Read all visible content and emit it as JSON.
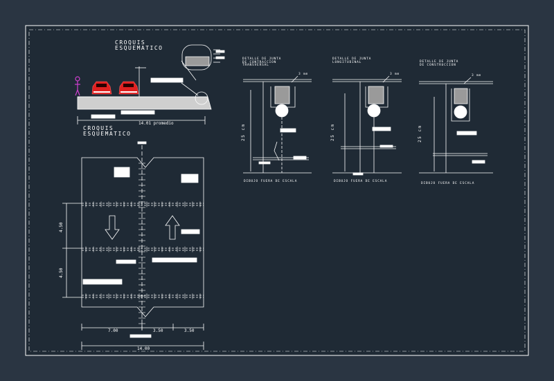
{
  "colors": {
    "background": "#2a3542",
    "sheet": "#1f2a35",
    "line": "#ffffff",
    "accent_car": "#e02020",
    "accent_person": "#d040d0",
    "hatch": "#bbbbbb"
  },
  "sketch_title": "CROQUIS\nESQUEMATICO",
  "plan_title": "CROQUIS\nESQUEMATICO",
  "profile": {
    "width_label": "14.01 promedio"
  },
  "plan": {
    "dim_bottom_total": "14.00",
    "dim_bottom_left": "7.00",
    "dim_bottom_mid": "3.50",
    "dim_bottom_right": "3.50",
    "dim_left_upper": "4.50",
    "dim_left_lower": "4.50"
  },
  "details": [
    {
      "title": "DETALLE DE JUNTA\nDE CONTRACCION\nTRANSVERSAL",
      "depth_label": "25 cm",
      "footer": "DIBUJO FUERA DE ESCALA",
      "mm_label": "3 mm"
    },
    {
      "title": "DETALLE DE JUNTA\nLONGITUDINAL",
      "depth_label": "25 cm",
      "footer": "DIBUJO FUERA DE ESCALA",
      "mm_label": "3 mm"
    },
    {
      "title": "DETALLE DE JUNTA\nDE CONSTRUCCION",
      "depth_label": "25 cm",
      "footer": "DIBUJO FUERA DE ESCALA",
      "mm_label": "3 mm"
    }
  ]
}
